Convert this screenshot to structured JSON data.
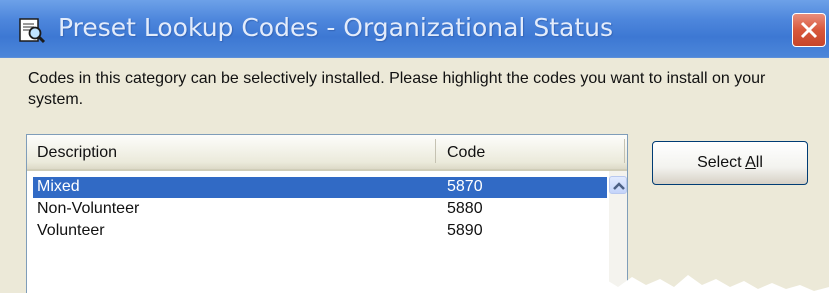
{
  "window": {
    "title": "Preset Lookup Codes - Organizational Status",
    "icon": "document-magnifier-icon",
    "close_icon": "close-icon"
  },
  "instructions": "Codes in this category can be selectively installed. Please highlight the codes you want to install on your system.",
  "list": {
    "columns": [
      "Description",
      "Code"
    ],
    "rows": [
      {
        "description": "Mixed",
        "code": "5870",
        "selected": true
      },
      {
        "description": "Non-Volunteer",
        "code": "5880",
        "selected": false
      },
      {
        "description": "Volunteer",
        "code": "5890",
        "selected": false
      }
    ]
  },
  "buttons": {
    "select_all_prefix": "Select ",
    "select_all_mnemonic": "A",
    "select_all_suffix": "ll"
  },
  "colors": {
    "titlebar": "#3d78d3",
    "selection": "#316ac5",
    "close": "#d8583c",
    "dialog_bg": "#ece9d8"
  }
}
